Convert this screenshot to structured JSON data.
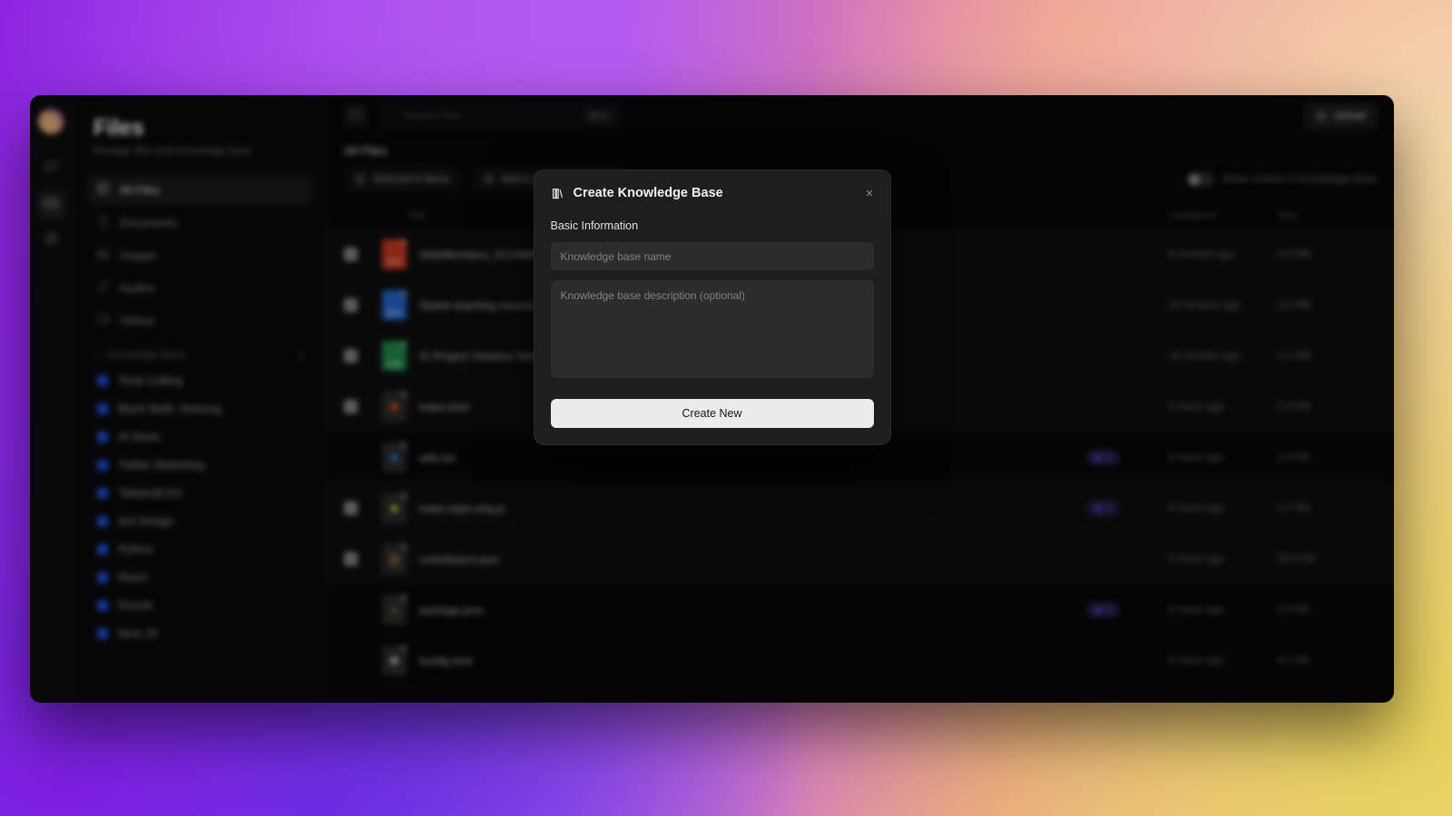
{
  "rail": {
    "avatar": "user-avatar",
    "items": [
      {
        "icon": "chat-icon",
        "active": false
      },
      {
        "icon": "folder-icon",
        "active": true
      },
      {
        "icon": "compass-icon",
        "active": false
      }
    ]
  },
  "sidebar": {
    "title": "Files",
    "subtitle": "Manage files and knowledge base",
    "nav": [
      {
        "label": "All Files",
        "icon": "grid-icon",
        "active": true
      },
      {
        "label": "Documents",
        "icon": "document-icon",
        "active": false
      },
      {
        "label": "Images",
        "icon": "image-icon",
        "active": false
      },
      {
        "label": "Audios",
        "icon": "audio-icon",
        "active": false
      },
      {
        "label": "Videos",
        "icon": "video-icon",
        "active": false
      }
    ],
    "kb_section": {
      "label": "Knowledge Base",
      "add": "+",
      "caret": "▾"
    },
    "kb_items": [
      {
        "label": "Tools Calling"
      },
      {
        "label": "Black Myth: Wukong"
      },
      {
        "label": "AI News"
      },
      {
        "label": "Twitter Marketing"
      },
      {
        "label": "TailwindCSS"
      },
      {
        "label": "Ant Design"
      },
      {
        "label": "Python"
      },
      {
        "label": "React"
      },
      {
        "label": "Drizzle"
      },
      {
        "label": "Next.JS"
      }
    ],
    "kb_dot_color": "#1d4ed8"
  },
  "topbar": {
    "panel_toggle": "panel-toggle-icon",
    "search": {
      "placeholder": "Search Files",
      "shortcut": "⌘ K",
      "icon": "search-icon"
    },
    "upload": {
      "label": "Upload",
      "icon": "upload-icon"
    }
  },
  "main": {
    "section_title": "All Files",
    "selected_chip": "Selected 6 items",
    "add_to_kb": "Add to Knowledge Base",
    "toggle_label": "Show content in Knowledge Base",
    "toggle_on": false
  },
  "table": {
    "columns": {
      "file": "File",
      "created": "Created At",
      "size": "Size"
    },
    "rows": [
      {
        "checked": true,
        "name": "SlideMembers_ECOMMERCE.pptx",
        "ext": "PPTX",
        "color": "#c8381f",
        "glyph": "",
        "badge": null,
        "created": "8 minutes ago",
        "size": "4.4 MB"
      },
      {
        "checked": true,
        "name": "Stylish teaching resume.docx",
        "ext": "DOCX",
        "color": "#2563c9",
        "glyph": "",
        "badge": null,
        "created": "15 minutes ago",
        "size": "3.0 MB"
      },
      {
        "checked": true,
        "name": "IC-Project-Timeline-Template.xlsx",
        "ext": "XLSX",
        "color": "#1f8a4c",
        "glyph": "",
        "badge": null,
        "created": "18 minutes ago",
        "size": "1.1 MB"
      },
      {
        "checked": true,
        "name": "index.html",
        "ext": "",
        "color": "#2a2a2a",
        "glyph": "◆",
        "glyph_color": "#e44d26",
        "badge": null,
        "created": "5 hours ago",
        "size": "0.3 KB"
      },
      {
        "checked": false,
        "name": "utils.tsx",
        "ext": "",
        "color": "#2a2a2a",
        "glyph": "◆",
        "glyph_color": "#3178c6",
        "badge": "1",
        "created": "5 hours ago",
        "size": "2.4 KB"
      },
      {
        "checked": true,
        "name": "index-style-only.js",
        "ext": "",
        "color": "#2a2a2a",
        "glyph": "■",
        "glyph_color": "#f0db4f",
        "badge": "1",
        "created": "5 hours ago",
        "size": "0.7 KB"
      },
      {
        "checked": true,
        "name": "contributors.json",
        "ext": "",
        "color": "#2a2a2a",
        "glyph": "{}",
        "glyph_color": "#d8a23a",
        "badge": null,
        "created": "5 hours ago",
        "size": "25.0 KB"
      },
      {
        "checked": false,
        "name": "package.json",
        "ext": "",
        "color": "#2a2a2a",
        "glyph": "●",
        "glyph_color": "#5a9e3a",
        "badge": "1",
        "created": "5 hours ago",
        "size": "0.9 KB"
      },
      {
        "checked": false,
        "name": "bunfig.toml",
        "ext": "",
        "color": "#2a2a2a",
        "glyph": "◈",
        "glyph_color": "#cfcfcf",
        "badge": null,
        "created": "5 hours ago",
        "size": "0.1 KB"
      }
    ]
  },
  "modal": {
    "title": "Create Knowledge Base",
    "icon": "book-icon",
    "close": "×",
    "section_label": "Basic Information",
    "name_placeholder": "Knowledge base name",
    "name_value": "",
    "description_placeholder": "Knowledge base description (optional)",
    "description_value": "",
    "submit_label": "Create New"
  },
  "colors": {
    "accent_purple": "#8b1fe0",
    "badge_purple": "#8f86d8",
    "kb_blue": "#1d4ed8",
    "submit_bg": "#ececec"
  }
}
